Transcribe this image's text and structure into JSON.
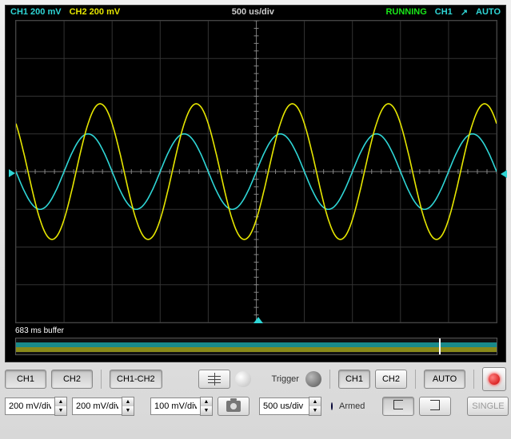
{
  "header": {
    "ch1": "CH1 200 mV",
    "ch2": "CH2 200 mV",
    "timebase": "500 us/div",
    "status": "RUNNING",
    "trigger_src": "CH1",
    "trigger_edge": "↗",
    "trigger_mode": "AUTO"
  },
  "buffer_label": "683 ms buffer",
  "controls": {
    "ch1_btn": "CH1",
    "ch2_btn": "CH2",
    "math_btn": "CH1-CH2",
    "trigger_lbl": "Trigger",
    "trig_ch1": "CH1",
    "trig_ch2": "CH2",
    "auto_btn": "AUTO",
    "single_btn": "SINGLE",
    "armed_lbl": "Armed",
    "ch1_scale": "200 mV/div",
    "ch2_scale": "200 mV/div",
    "math_scale": "100 mV/div",
    "time_scale": "500 us/div"
  },
  "colors": {
    "ch1": "#2fd6d6",
    "ch2": "#e6e600",
    "grid": "#333333",
    "bg": "#000000"
  },
  "chart_data": {
    "type": "line",
    "x_range_us": [
      -2500,
      2500
    ],
    "y_range_mv": [
      -800,
      800
    ],
    "x_divs": 10,
    "y_divs": 8,
    "timebase_us_per_div": 500,
    "vscale_mv_per_div": 200,
    "series": [
      {
        "name": "CH1",
        "color": "#2fd6d6",
        "amplitude_mv": 200,
        "period_us": 1000,
        "phase_deg": 0,
        "offset_mv": 0
      },
      {
        "name": "CH2",
        "color": "#e6e600",
        "amplitude_mv": 360,
        "period_us": 1000,
        "phase_deg": -45,
        "offset_mv": 0
      }
    ]
  }
}
